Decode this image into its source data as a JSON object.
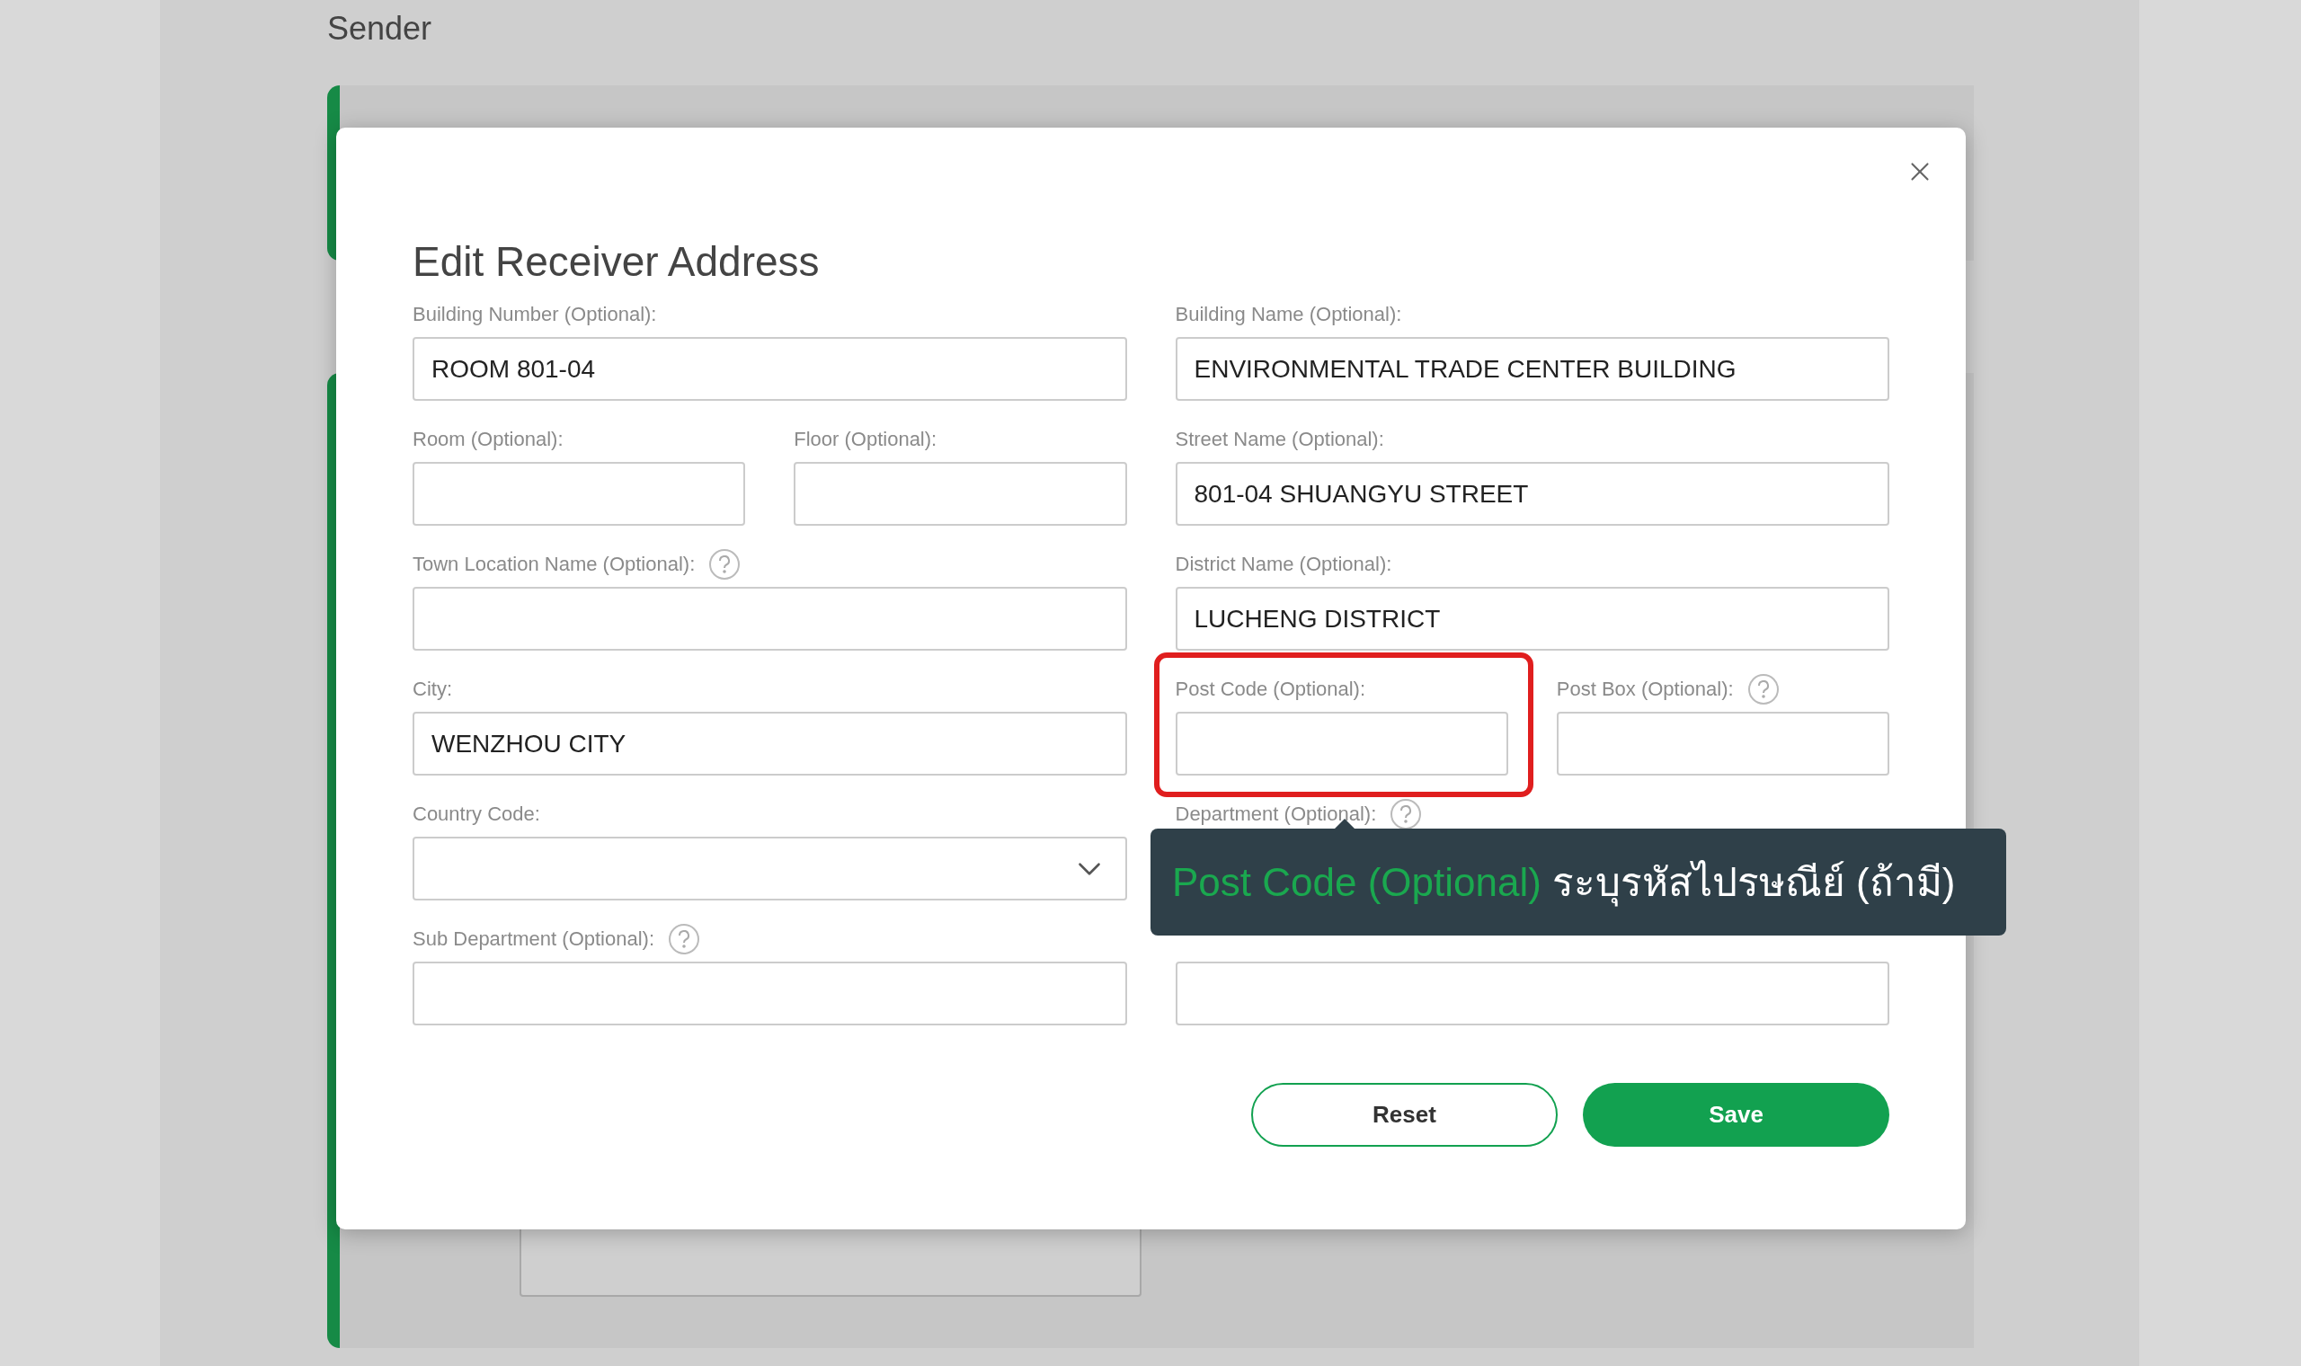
{
  "page": {
    "heading": "Sender"
  },
  "dialog": {
    "title": "Edit Receiver Address",
    "rows": [
      {
        "left": [
          {
            "label": "Building Number (Optional):",
            "value": "ROOM 801-04",
            "kind": "text",
            "help": false,
            "highlighted": false
          }
        ],
        "right": [
          {
            "label": "Building Name (Optional):",
            "value": "ENVIRONMENTAL TRADE CENTER BUILDING",
            "kind": "text",
            "help": false,
            "highlighted": false
          }
        ]
      },
      {
        "left": [
          {
            "label": "Room (Optional):",
            "kind": "text",
            "help": false,
            "highlighted": false
          },
          {
            "label": "Floor (Optional):",
            "kind": "text",
            "help": false,
            "highlighted": false
          }
        ],
        "right": [
          {
            "label": "Street Name (Optional):",
            "value": "801-04 SHUANGYU STREET",
            "kind": "text",
            "help": false,
            "highlighted": false
          }
        ]
      },
      {
        "left": [
          {
            "label": "Town Location Name (Optional):",
            "kind": "text",
            "help": true,
            "highlighted": false
          }
        ],
        "right": [
          {
            "label": "District Name (Optional):",
            "value": "LUCHENG DISTRICT",
            "kind": "text",
            "help": false,
            "highlighted": false
          }
        ]
      },
      {
        "left": [
          {
            "label": "City:",
            "value": "WENZHOU CITY",
            "kind": "text",
            "help": false,
            "highlighted": false
          }
        ],
        "right": [
          {
            "label": "Post Code (Optional):",
            "kind": "text",
            "help": false,
            "highlighted": true
          },
          {
            "label": "Post Box (Optional):",
            "kind": "text",
            "help": true,
            "highlighted": false
          }
        ]
      },
      {
        "left": [
          {
            "label": "Country Code:",
            "kind": "select",
            "help": false,
            "highlighted": false
          }
        ],
        "right": [
          {
            "label": "Department (Optional):",
            "kind": "covered",
            "help": true,
            "highlighted": false
          }
        ]
      },
      {
        "left": [
          {
            "label": "Sub Department (Optional):",
            "kind": "text",
            "help": true,
            "highlighted": false
          }
        ],
        "right": [
          {
            "kind": "text",
            "help": false,
            "highlighted": false
          }
        ]
      }
    ],
    "buttons": [
      {
        "label": "Reset",
        "kind": "secondary"
      },
      {
        "label": "Save",
        "kind": "primary"
      }
    ]
  },
  "tooltip": {
    "title": "Post Code (Optional)",
    "text": "ระบุรหัสไปรษณีย์ (ถ้ามี)"
  }
}
